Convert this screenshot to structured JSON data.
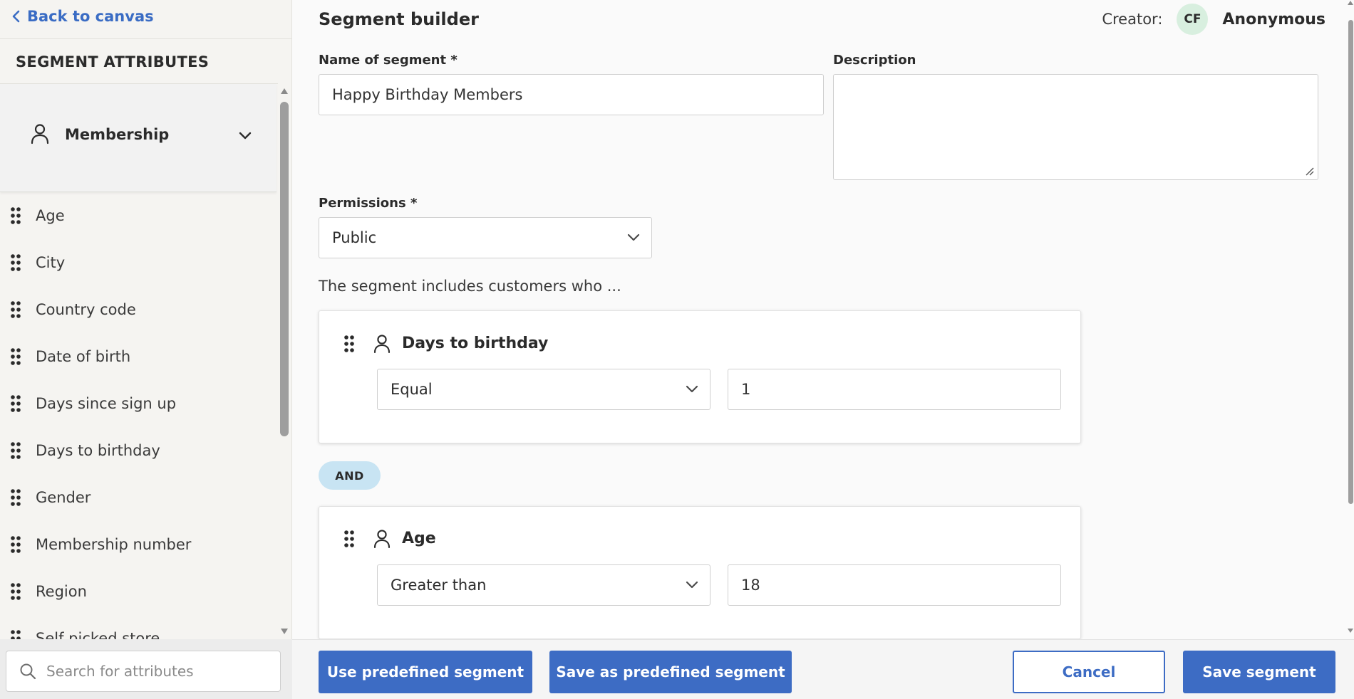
{
  "sidebar": {
    "back_label": "Back to canvas",
    "heading": "SEGMENT ATTRIBUTES",
    "group": {
      "label": "Membership"
    },
    "items": [
      {
        "label": "Age"
      },
      {
        "label": "City"
      },
      {
        "label": "Country code"
      },
      {
        "label": "Date of birth"
      },
      {
        "label": "Days since sign up"
      },
      {
        "label": "Days to birthday"
      },
      {
        "label": "Gender"
      },
      {
        "label": "Membership number"
      },
      {
        "label": "Region"
      },
      {
        "label": "Self picked store"
      }
    ],
    "search_placeholder": "Search for attributes"
  },
  "header": {
    "title": "Segment builder",
    "creator_label": "Creator:",
    "creator_initials": "CF",
    "creator_name": "Anonymous"
  },
  "form": {
    "name_label": "Name of segment *",
    "name_value": "Happy Birthday Members",
    "description_label": "Description",
    "description_value": "",
    "permissions_label": "Permissions *",
    "permissions_value": "Public",
    "intro_text": "The segment includes customers who ..."
  },
  "conditions": [
    {
      "attribute": "Days to birthday",
      "operator": "Equal",
      "value": "1"
    },
    {
      "attribute": "Age",
      "operator": "Greater than",
      "value": "18"
    }
  ],
  "connector_label": "AND",
  "footer": {
    "use_predefined": "Use predefined segment",
    "save_predefined": "Save as predefined segment",
    "cancel": "Cancel",
    "save": "Save segment"
  },
  "colors": {
    "accent": "#3d6cc4",
    "link": "#3a6cc4",
    "and_pill": "#c8e4f3",
    "avatar_bg": "#d8efdf"
  }
}
